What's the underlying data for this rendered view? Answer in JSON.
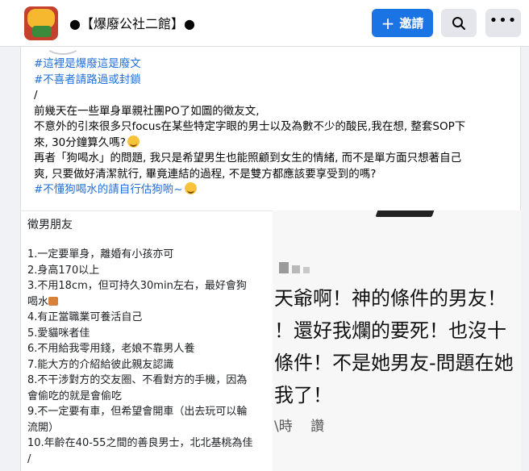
{
  "header": {
    "group_title": "●【爆廢公社二館】●",
    "invite_label": "邀請",
    "plus_icon": "+",
    "more_icon": "•••"
  },
  "post": {
    "tag_line1": "#這裡是爆廢這是廢文",
    "tag_line2": "#不喜者請路過或封鎖",
    "slash": "/",
    "line1": "前幾天在一些單身單親社團PO了如圖的徵友文,",
    "line2": "不意外的引來很多只focus在某些特定字眼的男士以及為數不少的酸民,我在想, 整套SOP下",
    "line3": "來, 30分鐘算久嗎?",
    "line4": "再者「狗喝水」的問題, 我只是希望男生也能照顧到女生的情緒, 而不是單方面只想著自己",
    "line5": "爽, 只要做好清潔就行, 畢竟連結的過程, 不是雙方都應該要享受到的嗎?",
    "tag_line3": "#不懂狗喝水的請自行估狗喲~"
  },
  "image_left": {
    "heading": "徵男朋友",
    "items": [
      "1.一定要單身，離婚有小孩亦可",
      "2.身高170以上",
      "3.不用18cm，但可持久30min左右，最好會狗",
      "喝水",
      "4.有正當職業可養活自己",
      "5.愛貓咪者佳",
      "6.不用給我零用錢，老娘不靠男人養",
      "7.能大方的介紹給彼此親友認識",
      "8.不干涉對方的交友圈、不看對方的手機，因為",
      "會偷吃的就是會偷吃",
      "9.不一定要有車，但希望會開車（出去玩可以輪",
      "流開）",
      "10.年齡在40-55之間的善良男士，北北基桃為佳",
      "/"
    ]
  },
  "image_right": {
    "line1": "天爺啊！神的條件的男友！",
    "line2": "！還好我爛的要死！也沒十",
    "line3": "條件！不是她男友-問題在她",
    "line4": "我了！",
    "meta": "\\時　 讚"
  }
}
